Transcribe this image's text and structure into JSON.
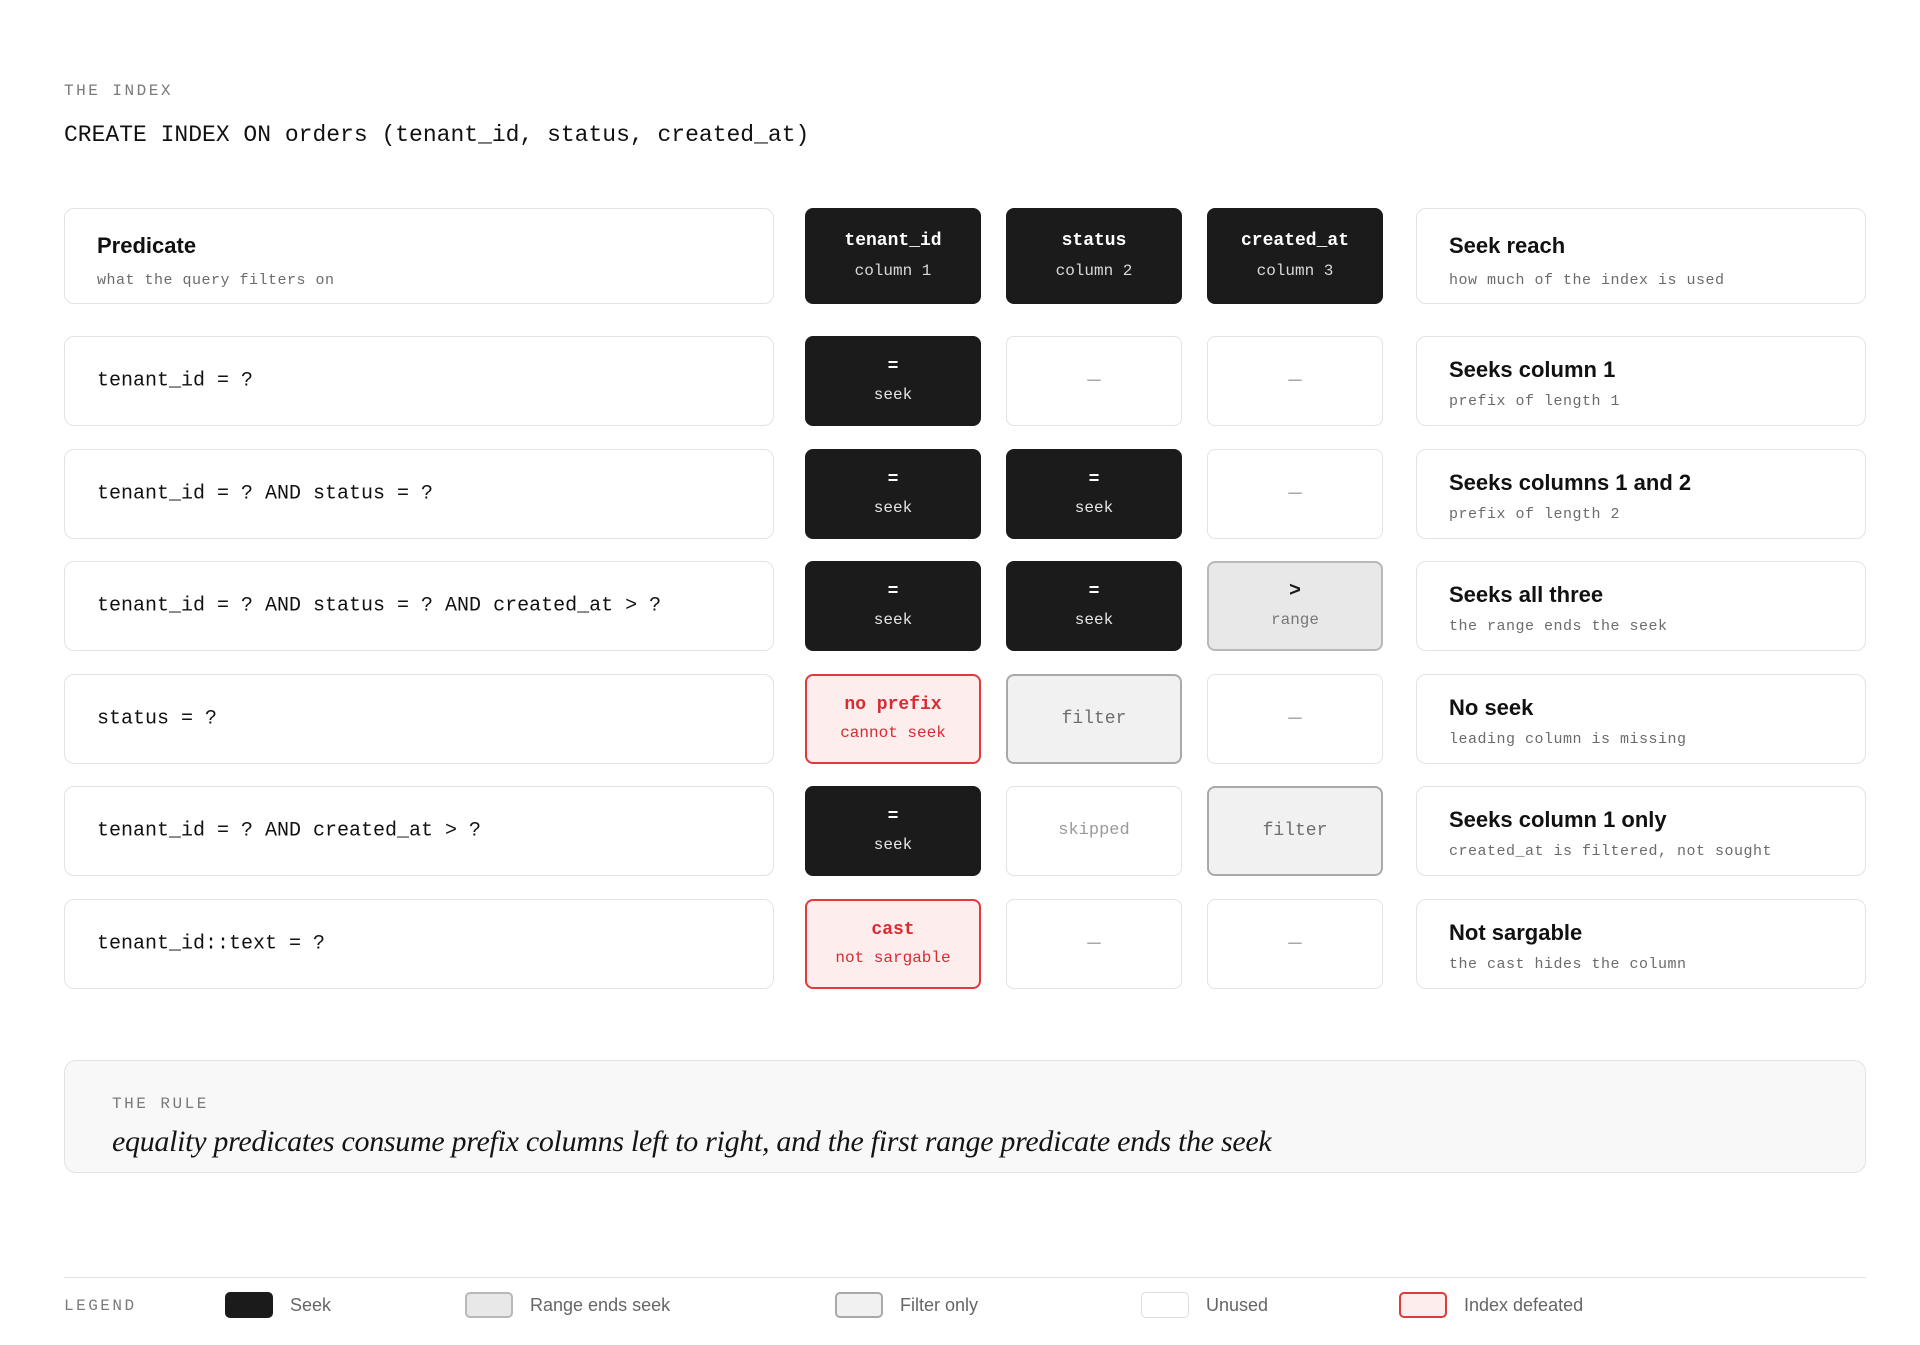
{
  "index": {
    "eyebrow": "THE INDEX",
    "sql": "CREATE INDEX ON orders (tenant_id, status, created_at)"
  },
  "header": {
    "predicate_title": "Predicate",
    "predicate_sub": "what the query filters on",
    "columns": [
      {
        "name": "tenant_id",
        "pos": "column 1"
      },
      {
        "name": "status",
        "pos": "column 2"
      },
      {
        "name": "created_at",
        "pos": "column 3"
      }
    ],
    "reach_title": "Seek reach",
    "reach_sub": "how much of the index is used"
  },
  "rows": [
    {
      "predicate": "tenant_id = ?",
      "cells": [
        {
          "kind": "seek",
          "l1": "=",
          "l2": "seek"
        },
        {
          "kind": "unused",
          "l1": "—",
          "l2": ""
        },
        {
          "kind": "unused",
          "l1": "—",
          "l2": ""
        }
      ],
      "reach_title": "Seeks column 1",
      "reach_sub": "prefix of length 1"
    },
    {
      "predicate": "tenant_id = ? AND status = ?",
      "cells": [
        {
          "kind": "seek",
          "l1": "=",
          "l2": "seek"
        },
        {
          "kind": "seek",
          "l1": "=",
          "l2": "seek"
        },
        {
          "kind": "unused",
          "l1": "—",
          "l2": ""
        }
      ],
      "reach_title": "Seeks columns 1 and 2",
      "reach_sub": "prefix of length 2"
    },
    {
      "predicate": "tenant_id = ? AND status = ? AND created_at > ?",
      "cells": [
        {
          "kind": "seek",
          "l1": "=",
          "l2": "seek"
        },
        {
          "kind": "seek",
          "l1": "=",
          "l2": "seek"
        },
        {
          "kind": "range",
          "l1": ">",
          "l2": "range"
        }
      ],
      "reach_title": "Seeks all three",
      "reach_sub": "the range ends the seek"
    },
    {
      "predicate": "status = ?",
      "cells": [
        {
          "kind": "defeated",
          "l1": "no prefix",
          "l2": "cannot seek"
        },
        {
          "kind": "filter",
          "l1": "filter",
          "l2": ""
        },
        {
          "kind": "unused",
          "l1": "—",
          "l2": ""
        }
      ],
      "reach_title": "No seek",
      "reach_sub": "leading column is missing"
    },
    {
      "predicate": "tenant_id = ? AND created_at > ?",
      "cells": [
        {
          "kind": "seek",
          "l1": "=",
          "l2": "seek"
        },
        {
          "kind": "skipped",
          "l1": "skipped",
          "l2": ""
        },
        {
          "kind": "filter",
          "l1": "filter",
          "l2": ""
        }
      ],
      "reach_title": "Seeks column 1 only",
      "reach_sub": "created_at is filtered, not sought"
    },
    {
      "predicate": "tenant_id::text = ?",
      "cells": [
        {
          "kind": "defeated",
          "l1": "cast",
          "l2": "not sargable"
        },
        {
          "kind": "unused",
          "l1": "—",
          "l2": ""
        },
        {
          "kind": "unused",
          "l1": "—",
          "l2": ""
        }
      ],
      "reach_title": "Not sargable",
      "reach_sub": "the cast hides the column"
    }
  ],
  "rule": {
    "eyebrow": "THE RULE",
    "text": "equality predicates consume prefix columns left to right, and the first range predicate ends the seek"
  },
  "legend": {
    "label": "LEGEND",
    "items": [
      {
        "kind": "seek",
        "label": "Seek"
      },
      {
        "kind": "range",
        "label": "Range ends seek"
      },
      {
        "kind": "filter",
        "label": "Filter only"
      },
      {
        "kind": "unused",
        "label": "Unused"
      },
      {
        "kind": "defeated",
        "label": "Index defeated"
      }
    ]
  },
  "colors": {
    "seek": "#1b1b1b",
    "range": "#e8e8e8",
    "filter": "#f1f1f1",
    "unused": "#ffffff",
    "defeated_fill": "#fdeded",
    "defeated_border": "#e0393e"
  }
}
